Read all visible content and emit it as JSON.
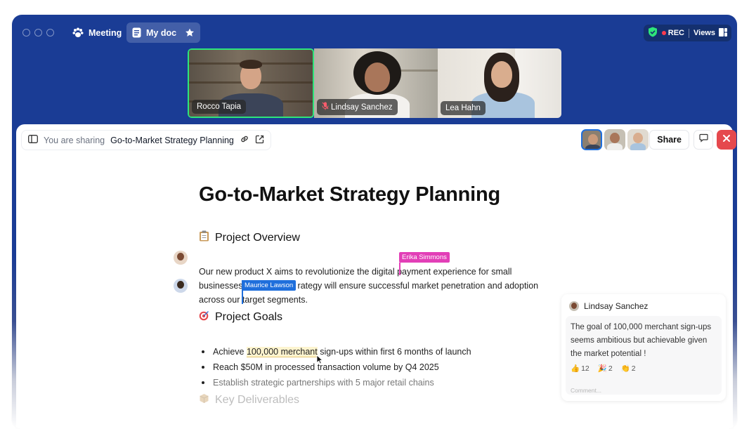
{
  "tabs": {
    "meeting": "Meeting",
    "mydoc": "My doc"
  },
  "controls": {
    "rec": "REC",
    "views": "Views"
  },
  "participants": [
    {
      "name": "Rocco Tapia"
    },
    {
      "name": "Lindsay Sanchez",
      "muted": true
    },
    {
      "name": "Lea Hahn"
    }
  ],
  "sharebar": {
    "prefix": "You are sharing",
    "doc_title": "Go-to-Market Strategy Planning"
  },
  "actions": {
    "share": "Share"
  },
  "document": {
    "title": "Go-to-Market Strategy Planning",
    "section1": {
      "heading": "Project Overview",
      "p1": "Our new product X aims to revolutionize the digital",
      "p1b": "payment experience for small",
      "p2a": "businesses",
      "p2b": "rategy will ensure successful market penetration and adoption",
      "p3a": "across our",
      "p3b": "target segments."
    },
    "section2": {
      "heading": "Project Goals",
      "b1_pre": "Achieve ",
      "b1_hl": "100,000 merchant",
      "b1_post": " sign-ups within first 6 months of launch",
      "b2": "Reach $50M in processed transaction volume by Q4 2025",
      "b3": "Establish strategic partnerships with 5 major retail chains"
    },
    "section3": {
      "heading": "Key Deliverables"
    }
  },
  "cursors": {
    "erika": "Erika Simmons",
    "maurice": "Maurice Lawson"
  },
  "comment": {
    "author": "Lindsay Sanchez",
    "text": "The goal of 100,000 merchant sign-ups seems ambitious but achievable given the market potential !",
    "reactions": [
      {
        "emoji": "👍",
        "count": "12"
      },
      {
        "emoji": "🎉",
        "count": "2"
      },
      {
        "emoji": "👏",
        "count": "2"
      }
    ],
    "placeholder": "Comment..."
  },
  "colors": {
    "frame_blue": "#1a3c95",
    "active_speaker": "#2ee57a",
    "erika_cursor": "#e23fb7",
    "maurice_cursor": "#1f6fdc",
    "close_red": "#e5484d",
    "shield_green": "#2ee57a"
  }
}
